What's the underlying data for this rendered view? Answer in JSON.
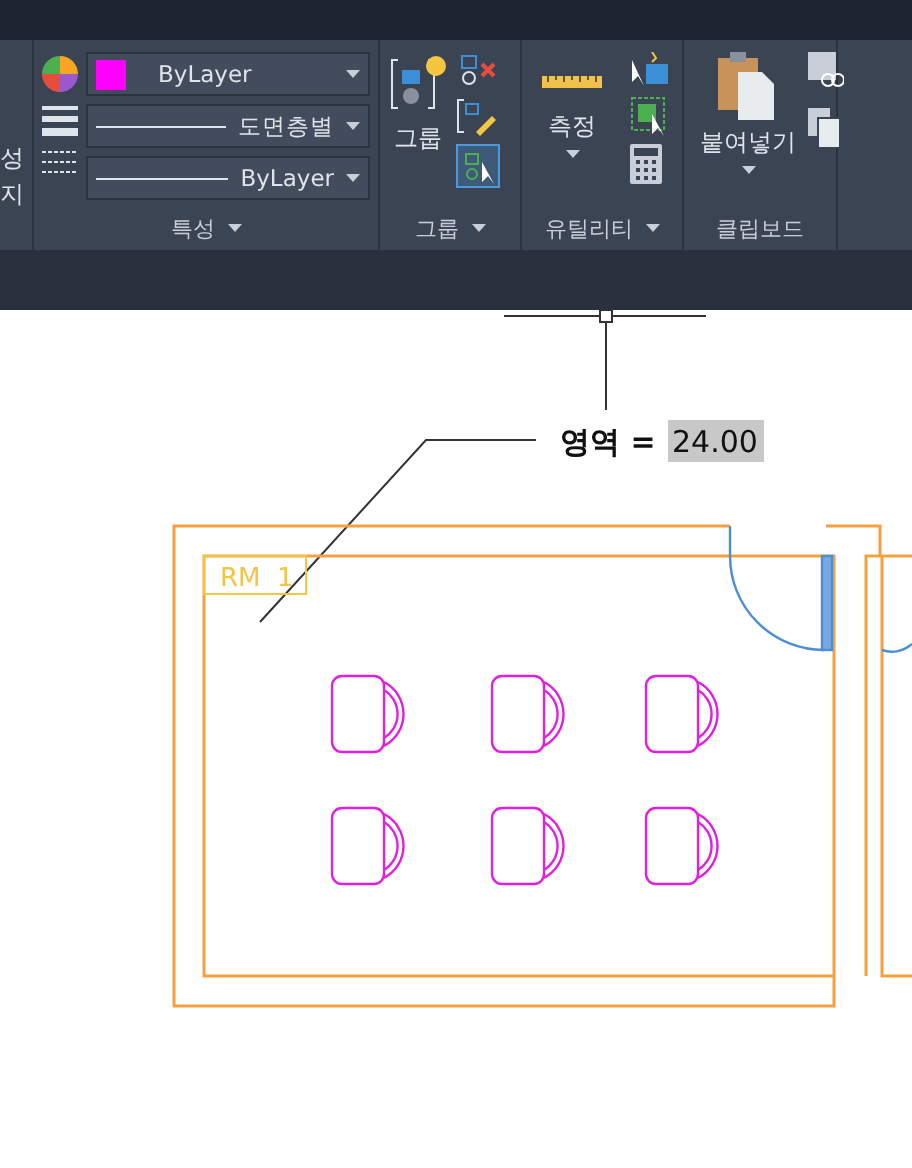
{
  "left_panel": {
    "labels": [
      "성",
      "지"
    ]
  },
  "properties": {
    "title": "특성",
    "combos": [
      {
        "kind": "color",
        "value": "ByLayer",
        "color": "#ff00ff"
      },
      {
        "kind": "line",
        "value": "도면층별"
      },
      {
        "kind": "line",
        "value": "ByLayer"
      }
    ]
  },
  "group_panel": {
    "title": "그룹",
    "button": "그룹"
  },
  "utilities_panel": {
    "title": "유틸리티",
    "button": "측정"
  },
  "clipboard_panel": {
    "title": "클립보드",
    "button": "붙여넣기"
  },
  "drawing": {
    "area_label": "영역 =",
    "area_value": "24.00",
    "room_tag": "RM  1"
  }
}
